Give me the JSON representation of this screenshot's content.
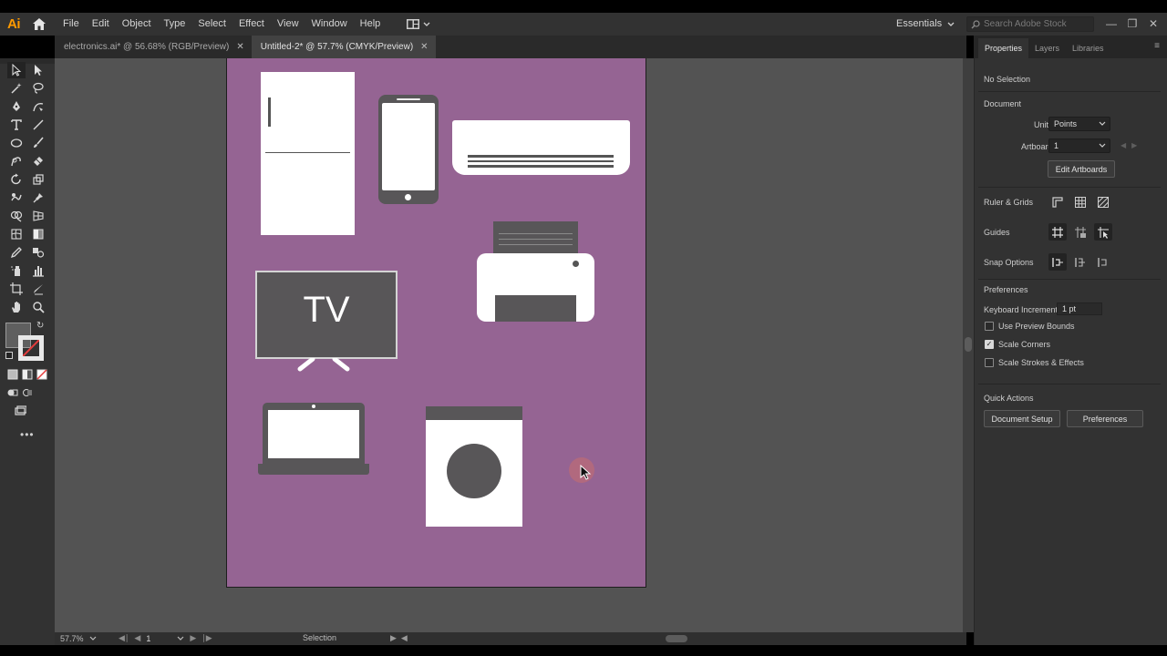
{
  "app": {
    "logo": "Ai",
    "menu": [
      "File",
      "Edit",
      "Object",
      "Type",
      "Select",
      "Effect",
      "View",
      "Window",
      "Help"
    ],
    "workspace": "Essentials",
    "search_placeholder": "Search Adobe Stock"
  },
  "tabs": [
    {
      "label": "electronics.ai* @ 56.68% (RGB/Preview)",
      "active": false
    },
    {
      "label": "Untitled-2* @ 57.7% (CMYK/Preview)",
      "active": true
    }
  ],
  "artboard": {
    "background": "#956493",
    "tv_label": "TV"
  },
  "status": {
    "zoom": "57.7%",
    "page": "1",
    "tool": "Selection"
  },
  "panel": {
    "tabs": [
      "Properties",
      "Layers",
      "Libraries"
    ],
    "selection": "No Selection",
    "document_heading": "Document",
    "units_label": "Units:",
    "units_value": "Points",
    "artboard_label": "Artboard:",
    "artboard_value": "1",
    "edit_artboards": "Edit Artboards",
    "ruler_grids": "Ruler & Grids",
    "guides": "Guides",
    "snap_options": "Snap Options",
    "preferences_heading": "Preferences",
    "keyboard_increment_label": "Keyboard Increment:",
    "keyboard_increment_value": "1 pt",
    "checks": [
      {
        "label": "Use Preview Bounds",
        "checked": false
      },
      {
        "label": "Scale Corners",
        "checked": true
      },
      {
        "label": "Scale Strokes & Effects",
        "checked": false
      }
    ],
    "quick_actions": "Quick Actions",
    "document_setup": "Document Setup",
    "preferences_button": "Preferences"
  }
}
